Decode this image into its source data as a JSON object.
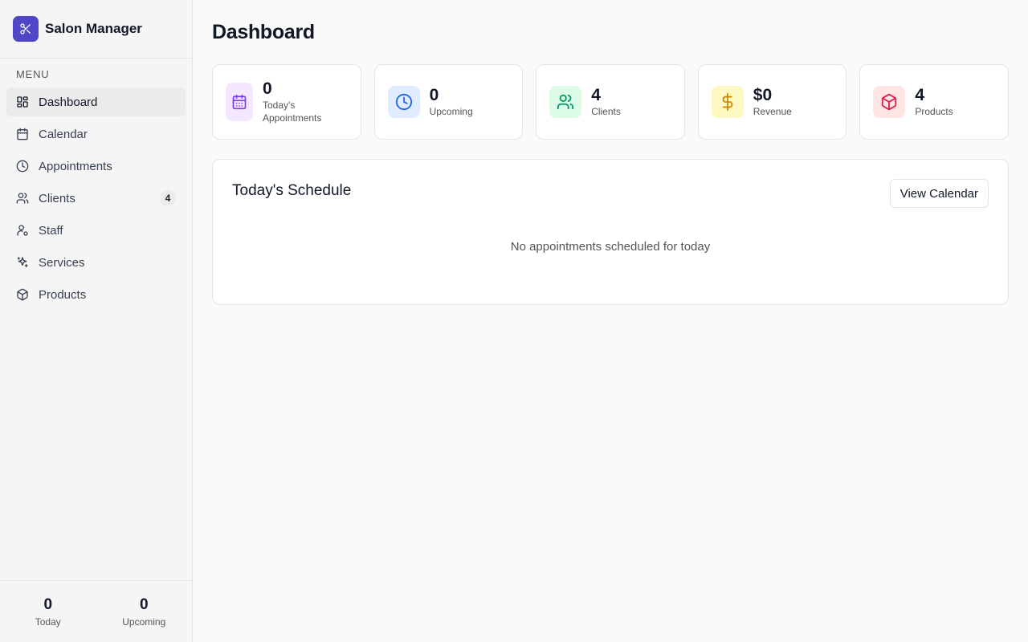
{
  "app": {
    "name": "Salon Manager",
    "brand_color": "#4f46c8",
    "logo_icon": "scissors-icon"
  },
  "sidebar": {
    "menu_label": "MENU",
    "items": [
      {
        "label": "Dashboard",
        "icon": "dashboard-icon",
        "active": true
      },
      {
        "label": "Calendar",
        "icon": "calendar-icon"
      },
      {
        "label": "Appointments",
        "icon": "clock-icon"
      },
      {
        "label": "Clients",
        "icon": "users-icon",
        "badge": "4"
      },
      {
        "label": "Staff",
        "icon": "staff-icon"
      },
      {
        "label": "Services",
        "icon": "sparkles-icon"
      },
      {
        "label": "Products",
        "icon": "package-icon"
      }
    ],
    "footer": {
      "today_value": "0",
      "today_label": "Today",
      "upcoming_value": "0",
      "upcoming_label": "Upcoming"
    }
  },
  "main": {
    "title": "Dashboard",
    "stats": [
      {
        "value": "0",
        "label": "Today's Appointments",
        "icon": "calendar-icon",
        "color": "#7c3aed",
        "bg": "#f3e8ff"
      },
      {
        "value": "0",
        "label": "Upcoming",
        "icon": "clock-icon",
        "color": "#2563eb",
        "bg": "#e0ecff"
      },
      {
        "value": "4",
        "label": "Clients",
        "icon": "users-icon",
        "color": "#059669",
        "bg": "#dcfce7"
      },
      {
        "value": "$0",
        "label": "Revenue",
        "icon": "dollar-icon",
        "color": "#ca8a04",
        "bg": "#fef9c3"
      },
      {
        "value": "4",
        "label": "Products",
        "icon": "package-icon",
        "color": "#e11d48",
        "bg": "#ffe4e6"
      }
    ],
    "schedule": {
      "title": "Today's Schedule",
      "button_label": "View Calendar",
      "empty_message": "No appointments scheduled for today"
    }
  }
}
